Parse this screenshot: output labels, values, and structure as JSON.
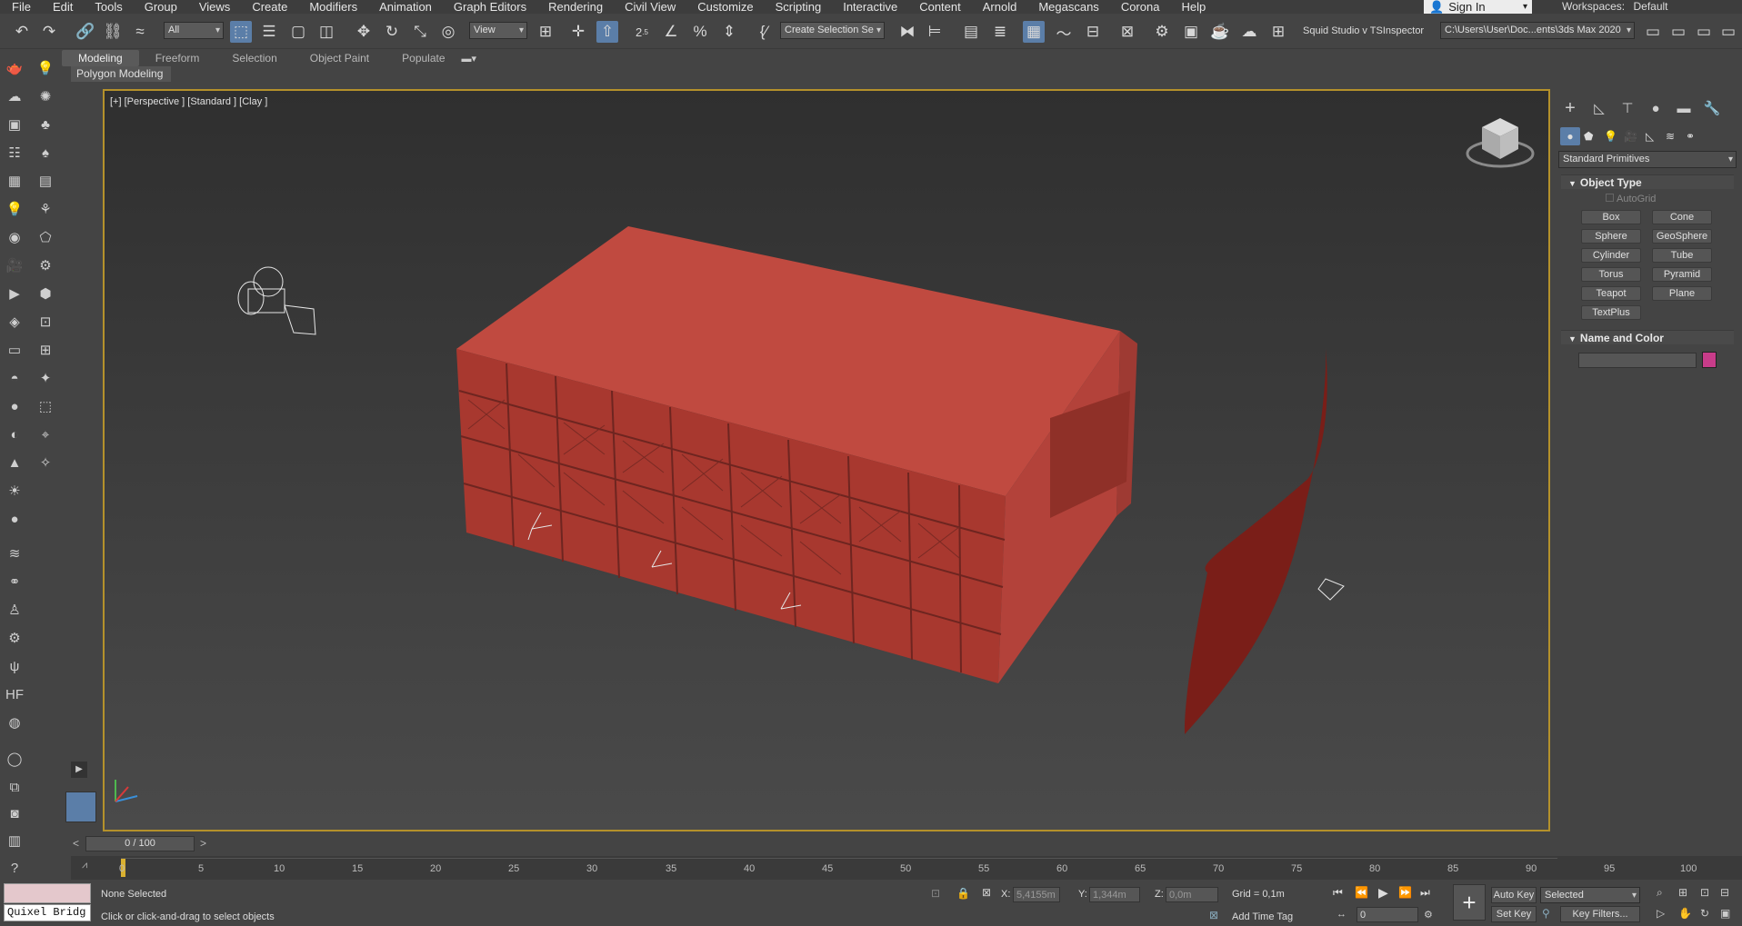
{
  "menu": [
    "File",
    "Edit",
    "Tools",
    "Group",
    "Views",
    "Create",
    "Modifiers",
    "Animation",
    "Graph Editors",
    "Rendering",
    "Civil View",
    "Customize",
    "Scripting",
    "Interactive",
    "Content",
    "Arnold",
    "Megascans",
    "Corona",
    "Help"
  ],
  "account": {
    "sign_in": "Sign In",
    "workspaces_label": "Workspaces:",
    "workspace": "Default"
  },
  "toolbar": {
    "filter_select": "All",
    "ref_coord": "View",
    "selection_set": "Create Selection Se",
    "snap_value": "2.5",
    "plugins_text": "Squid Studio v  TSInspector",
    "project_path": "C:\\Users\\User\\Doc...ents\\3ds Max 2020"
  },
  "ribbon": {
    "tabs": [
      "Modeling",
      "Freeform",
      "Selection",
      "Object Paint",
      "Populate"
    ],
    "active": "Modeling",
    "sub": "Polygon Modeling"
  },
  "viewport": {
    "label": "[+] [Perspective ] [Standard ] [Clay ]"
  },
  "command_panel": {
    "category": "Standard Primitives",
    "object_type_title": "Object Type",
    "autogrid": "AutoGrid",
    "buttons": [
      "Box",
      "Cone",
      "Sphere",
      "GeoSphere",
      "Cylinder",
      "Tube",
      "Torus",
      "Pyramid",
      "Teapot",
      "Plane",
      "TextPlus"
    ],
    "name_color_title": "Name and Color",
    "object_color": "#c83c8a"
  },
  "timeline": {
    "frame": "0 / 100",
    "ticks": [
      "0",
      "5",
      "10",
      "15",
      "20",
      "25",
      "30",
      "35",
      "40",
      "45",
      "50",
      "55",
      "60",
      "65",
      "70",
      "75",
      "80",
      "85",
      "90",
      "95",
      "100"
    ]
  },
  "status": {
    "listener": "Quixel Bridg",
    "selection": "None Selected",
    "prompt": "Click or click-and-drag to select objects",
    "x_label": "X:",
    "x": "5,4155m",
    "y_label": "Y:",
    "y": "1,344m",
    "z_label": "Z:",
    "z": "0,0m",
    "grid": "Grid = 0,1m",
    "add_time_tag": "Add Time Tag",
    "auto_key": "Auto Key",
    "set_key": "Set Key",
    "key_mode": "Selected",
    "frame_field": "0",
    "key_filters": "Key Filters..."
  }
}
